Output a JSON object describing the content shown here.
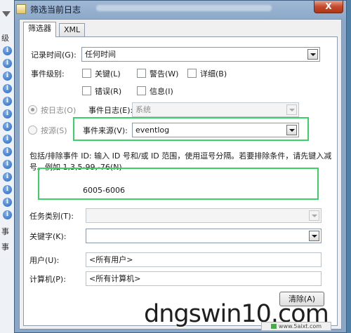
{
  "background": {
    "fragments": [
      "级",
      "事",
      "事"
    ]
  },
  "window": {
    "title": "筛选当前日志",
    "close_label": "X"
  },
  "tabs": [
    {
      "label": "筛选器",
      "active": true
    },
    {
      "label": "XML",
      "active": false
    }
  ],
  "form": {
    "logged_label": "记录时间(G):",
    "logged_value": "任何时间",
    "level_label": "事件级别:",
    "levels": [
      {
        "label": "关键(L)",
        "checked": false
      },
      {
        "label": "警告(W)",
        "checked": false
      },
      {
        "label": "详细(B)",
        "checked": false
      },
      {
        "label": "错误(R)",
        "checked": false
      },
      {
        "label": "信息(I)",
        "checked": false
      }
    ],
    "by_log_label": "按日志(O)",
    "by_source_label": "按源(S)",
    "event_log_label": "事件日志(E):",
    "event_log_value": "系统",
    "event_source_label": "事件来源(V):",
    "event_source_value": "eventlog",
    "ids_help_line1": "包括/排除事件 ID: 输入 ID 号和/或 ID 范围，使用逗号分隔。若要排除条件，请先键入减",
    "ids_help_line2": "号。例如 1,3,5-99,-76(N)",
    "ids_value": "6005-6006",
    "task_category_label": "任务类别(T):",
    "task_category_value": "",
    "keywords_label": "关键字(K):",
    "keywords_value": "",
    "user_label": "用户(U):",
    "user_value": "<所有用户>",
    "computer_label": "计算机(P):",
    "computer_value": "<所有计算机>",
    "clear_button": "清除(A)"
  },
  "watermark": {
    "main": "dngswin10.com",
    "small": "www.5aixt.com"
  },
  "colors": {
    "highlight": "#3bd166",
    "title_bar": "#8aa7c8",
    "close_button": "#c44a2b"
  }
}
